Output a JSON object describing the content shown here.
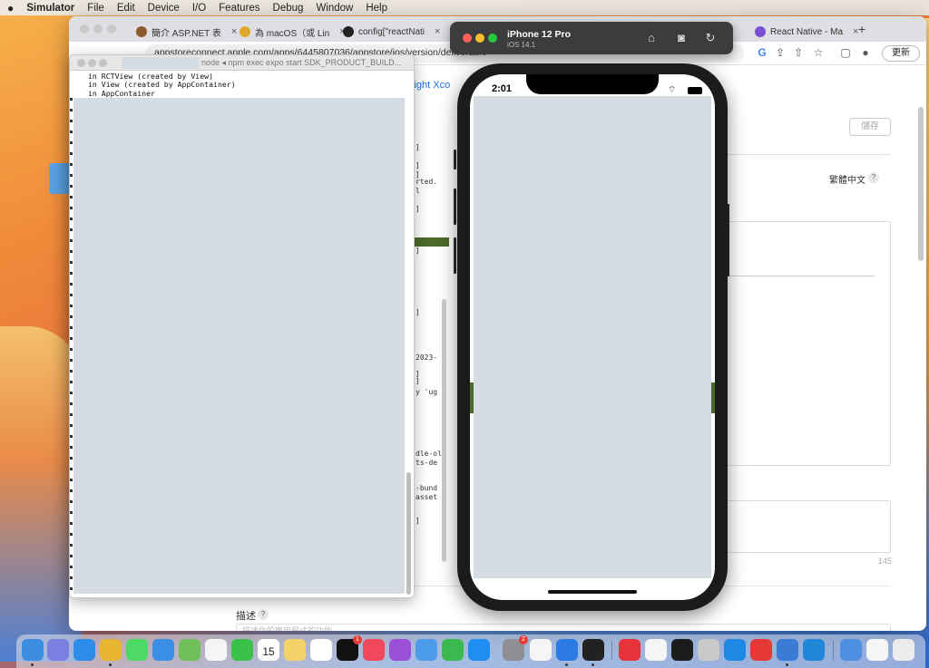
{
  "menubar": {
    "apple": "",
    "items": [
      "Simulator",
      "File",
      "Edit",
      "Device",
      "I/O",
      "Features",
      "Debug",
      "Window",
      "Help"
    ]
  },
  "browser": {
    "tabs": [
      {
        "label": "簡介 ASP.NET 表",
        "icon": "pinwheel-icon"
      },
      {
        "label": "為 macOS（或 Lin",
        "icon": "pear-icon"
      },
      {
        "label": "config[\"reactNati",
        "icon": "github-icon"
      },
      {
        "label": "React Native - Ma",
        "icon": "react-icon"
      }
    ],
    "url": "appstoreconnect.apple.com/apps/6445807036/appstore/ios/version/deliverable",
    "update_label": "更新",
    "new_tab": "+"
  },
  "page": {
    "tabs_partial": "light   Xco",
    "save_label": "儲存",
    "language_label": "繁體中文",
    "help_badge": "?",
    "char_count": "145",
    "description_label": "描述",
    "description_placeholder": "描述你的應用程式的功能"
  },
  "log_strip": {
    "lines": [
      "]",
      "]",
      "]",
      "rted.",
      "l",
      "]",
      "]",
      "]",
      "2023-",
      "]",
      "]",
      "y 'ug",
      "dle-ol",
      "ts-de",
      "-bund",
      "asset",
      "]"
    ]
  },
  "terminal": {
    "title": "node ◂ npm exec expo start SDK_PRODUCT_BUILD...",
    "lines": [
      "in RCTView (created by View)",
      "in View (created by AppContainer)",
      "in AppContainer"
    ]
  },
  "simulator": {
    "device": "iPhone 12 Pro",
    "os": "iOS 14.1",
    "time": "2:01",
    "icons": [
      "home-icon",
      "screenshot-icon",
      "rotate-icon"
    ]
  },
  "dock": {
    "calendar_day": "15",
    "badges": {
      "appletv": "1",
      "settings": "2"
    }
  }
}
